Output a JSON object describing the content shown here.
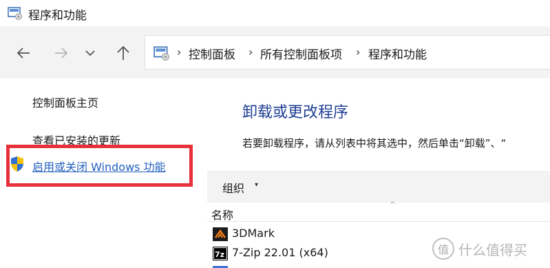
{
  "window": {
    "title": "程序和功能",
    "title_icon": "control-panel-icon"
  },
  "navigation": {
    "back_icon": "arrow-left-icon",
    "forward_icon": "arrow-right-icon",
    "recent_icon": "chevron-down-icon",
    "up_icon": "arrow-up-icon",
    "breadcrumbs": [
      "控制面板",
      "所有控制面板项",
      "程序和功能"
    ],
    "separator": "›"
  },
  "left_pane": {
    "home_link": "控制面板主页",
    "updates_link": "查看已安装的更新",
    "features_link": "启用或关闭 Windows 功能",
    "features_icon": "shield-icon",
    "highlight_color": "#e8303a"
  },
  "main": {
    "title": "卸载或更改程序",
    "description": "若要卸载程序，请从列表中将其选中，然后单击“卸载”、“",
    "toolbar": {
      "organize_label": "组织",
      "organize_caret": "▾"
    },
    "columns": {
      "name_label": "名称",
      "sort_icon": "^"
    },
    "programs": [
      {
        "name": "3DMark",
        "icon": "3dmark-icon"
      },
      {
        "name": "7-Zip 22.01 (x64)",
        "icon": "7zip-icon"
      }
    ],
    "title_color": "#1e3f93"
  },
  "watermark": {
    "logo": "值",
    "text": "什么值得买"
  }
}
